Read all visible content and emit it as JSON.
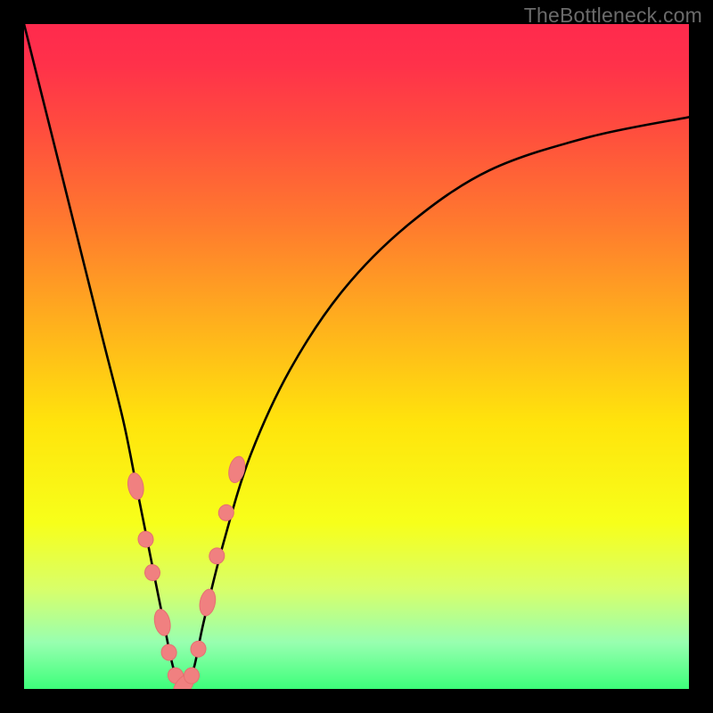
{
  "watermark": "TheBottleneck.com",
  "colors": {
    "frame_bg": "#000000",
    "curve_stroke": "#000000",
    "blob_fill": "#f08080",
    "blob_stroke": "#e57070",
    "gradient_stops": [
      {
        "stop": 0.0,
        "hex": "#ff2a4d"
      },
      {
        "stop": 0.06,
        "hex": "#ff314a"
      },
      {
        "stop": 0.15,
        "hex": "#ff4a3f"
      },
      {
        "stop": 0.3,
        "hex": "#ff7a2e"
      },
      {
        "stop": 0.45,
        "hex": "#ffb01d"
      },
      {
        "stop": 0.6,
        "hex": "#ffe40c"
      },
      {
        "stop": 0.75,
        "hex": "#f7ff1a"
      },
      {
        "stop": 0.85,
        "hex": "#d8ff6a"
      },
      {
        "stop": 0.93,
        "hex": "#98ffb0"
      },
      {
        "stop": 1.0,
        "hex": "#3dff7a"
      }
    ]
  },
  "chart_data": {
    "type": "line",
    "title": "",
    "xlabel": "",
    "ylabel": "",
    "xlim": [
      0,
      100
    ],
    "ylim": [
      0,
      100
    ],
    "series": [
      {
        "name": "bottleneck-curve",
        "x": [
          0,
          3,
          6,
          9,
          12,
          15,
          17,
          19,
          21,
          22.5,
          24,
          25.5,
          27,
          30,
          34,
          40,
          48,
          58,
          70,
          85,
          100
        ],
        "y": [
          100,
          88,
          76,
          64,
          52,
          40,
          30,
          20,
          10,
          3,
          0,
          3,
          10,
          22,
          35,
          48,
          60,
          70,
          78,
          83,
          86
        ]
      },
      {
        "name": "highlight-blobs",
        "x": [
          16.8,
          18.3,
          19.3,
          20.8,
          21.8,
          22.8,
          24.0,
          25.2,
          26.2,
          27.6,
          29.0,
          30.4,
          32.0
        ],
        "y": [
          30.5,
          22.5,
          17.5,
          10.0,
          5.5,
          2.0,
          0.5,
          2.0,
          6.0,
          13.0,
          20.0,
          26.5,
          33.0
        ]
      }
    ],
    "annotations": [
      {
        "text": "TheBottleneck.com",
        "pos": "top-right"
      }
    ]
  }
}
